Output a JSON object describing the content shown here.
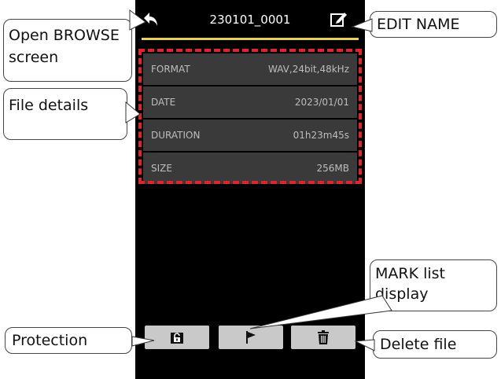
{
  "device": {
    "title": "230101_0001",
    "accent_color": "#e8d25f"
  },
  "details": [
    {
      "label": "FORMAT",
      "value": "WAV,24bit,48kHz"
    },
    {
      "label": "DATE",
      "value": "2023/01/01"
    },
    {
      "label": "DURATION",
      "value": "01h23m45s"
    },
    {
      "label": "SIZE",
      "value": "256MB"
    }
  ],
  "buttons": {
    "protect_icon": "unlock-icon",
    "mark_icon": "flag-icon",
    "delete_icon": "trash-icon"
  },
  "callouts": {
    "browse_line1": "Open BROWSE",
    "browse_line2": "screen",
    "file_details": "File details",
    "edit_name": "EDIT NAME",
    "mark_line1": "MARK list",
    "mark_line2": "display",
    "protection": "Protection",
    "delete_file": "Delete file"
  }
}
